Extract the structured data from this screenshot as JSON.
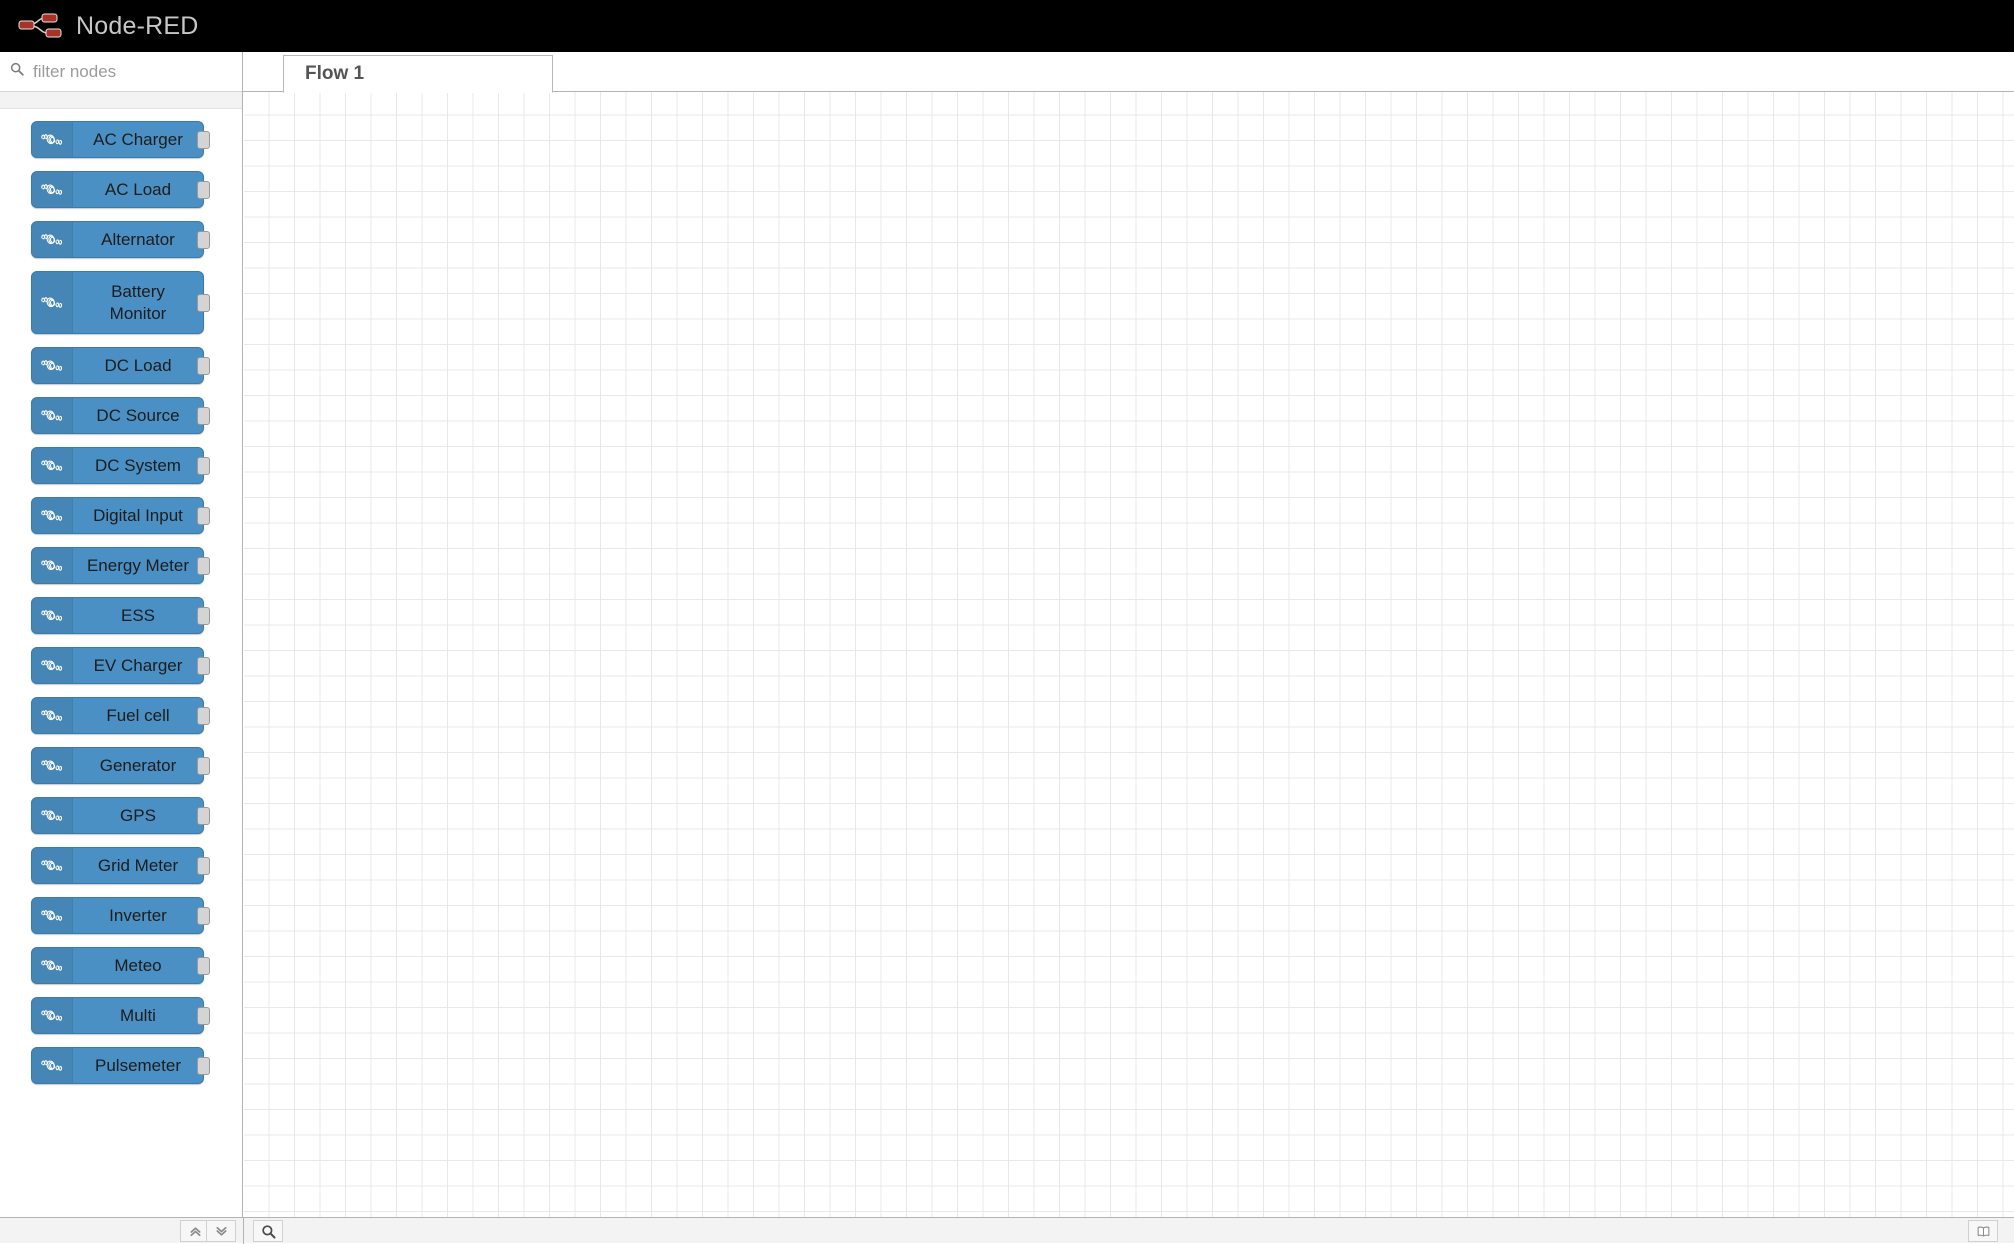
{
  "header": {
    "title": "Node-RED",
    "logo_icon": "node-red-logo-icon"
  },
  "palette": {
    "search": {
      "placeholder": "filter nodes",
      "value": "",
      "icon": "search-icon"
    },
    "node_icon": "victron-energy-logo-icon",
    "nodes": [
      {
        "label": "AC Charger",
        "lines": 1
      },
      {
        "label": "AC Load",
        "lines": 1
      },
      {
        "label": "Alternator",
        "lines": 1
      },
      {
        "label": "Battery\nMonitor",
        "lines": 2
      },
      {
        "label": "DC Load",
        "lines": 1
      },
      {
        "label": "DC Source",
        "lines": 1
      },
      {
        "label": "DC System",
        "lines": 1
      },
      {
        "label": "Digital Input",
        "lines": 1
      },
      {
        "label": "Energy Meter",
        "lines": 1
      },
      {
        "label": "ESS",
        "lines": 1
      },
      {
        "label": "EV Charger",
        "lines": 1
      },
      {
        "label": "Fuel cell",
        "lines": 1
      },
      {
        "label": "Generator",
        "lines": 1
      },
      {
        "label": "GPS",
        "lines": 1
      },
      {
        "label": "Grid Meter",
        "lines": 1
      },
      {
        "label": "Inverter",
        "lines": 1
      },
      {
        "label": "Meteo",
        "lines": 1
      },
      {
        "label": "Multi",
        "lines": 1
      },
      {
        "label": "Pulsemeter",
        "lines": 1
      }
    ]
  },
  "workspace": {
    "tabs": [
      {
        "label": "Flow 1",
        "active": true
      }
    ]
  },
  "footer": {
    "collapse_all_icon": "chevron-double-up-icon",
    "expand_all_icon": "chevron-double-down-icon",
    "search_flows_icon": "search-icon",
    "manual_icon": "book-icon"
  },
  "colors": {
    "header_bg": "#000000",
    "node_blue": "#4a90c4",
    "logo_red": "#a93226",
    "grid_line": "#e8e8e8"
  }
}
